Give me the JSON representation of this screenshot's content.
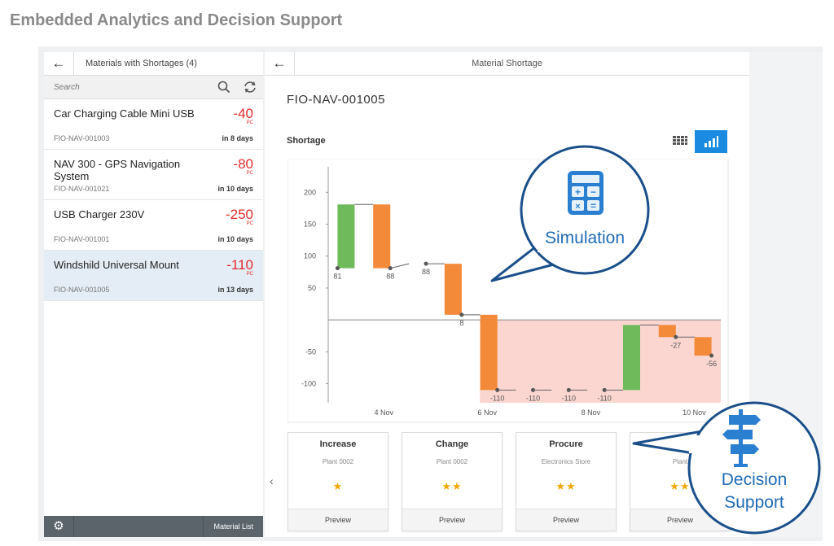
{
  "slide": {
    "title": "Embedded Analytics and Decision Support"
  },
  "master": {
    "header_title": "Materials with Shortages (4)",
    "search_placeholder": "Search",
    "items": [
      {
        "title": "Car Charging Cable Mini USB",
        "id": "FIO-NAV-001003",
        "qty": "-40",
        "unit": "PC",
        "days": "in 8 days"
      },
      {
        "title": "NAV 300 - GPS Navigation System",
        "id": "FIO-NAV-001021",
        "qty": "-80",
        "unit": "PC",
        "days": "in 10 days"
      },
      {
        "title": "USB Charger 230V",
        "id": "FIO-NAV-001001",
        "qty": "-250",
        "unit": "PC",
        "days": "in 10 days"
      },
      {
        "title": "Windshild Universal Mount",
        "id": "FIO-NAV-001005",
        "qty": "-110",
        "unit": "PC",
        "days": "in 13 days",
        "selected": true
      }
    ],
    "footer_button": "Material List"
  },
  "detail": {
    "header_title": "Material Shortage",
    "object_title": "FIO-NAV-001005",
    "chart_section_label": "Shortage",
    "cards": [
      {
        "title": "Increase",
        "subtitle": "Plant 0002",
        "stars": "★",
        "preview": "Preview"
      },
      {
        "title": "Change",
        "subtitle": "Plant 0002",
        "stars": "★★",
        "preview": "Preview"
      },
      {
        "title": "Procure",
        "subtitle": "Electronics Store",
        "stars": "★★",
        "preview": "Preview"
      },
      {
        "title": "",
        "subtitle": "Plant",
        "stars": "★★",
        "preview": "Preview"
      }
    ]
  },
  "callouts": {
    "simulation": "Simulation",
    "decision_1": "Decision",
    "decision_2": "Support"
  },
  "colors": {
    "increase": "#6fba5a",
    "decrease": "#f28a3a",
    "shortage_area": "#fbd6d0",
    "accent": "#1a8ae0",
    "callout": "#1a4f8a",
    "qty_red": "#e32b2b"
  },
  "chart_data": {
    "type": "bar",
    "subtype": "waterfall",
    "title": "",
    "xlabel": "",
    "ylabel": "",
    "ylim": [
      -130,
      240
    ],
    "yticks": [
      200,
      150,
      100,
      50,
      -50,
      -100
    ],
    "xtick_labels": [
      "4 Nov",
      "6 Nov",
      "8 Nov",
      "10 Nov"
    ],
    "steps": [
      {
        "start": 81,
        "end": 181,
        "kind": "increase"
      },
      {
        "start": 181,
        "end": 81,
        "kind": "decrease",
        "label": "88"
      },
      {
        "start": 88,
        "end": 88,
        "kind": "flat",
        "label": "88"
      },
      {
        "start": 88,
        "end": 8,
        "kind": "decrease",
        "label": "8"
      },
      {
        "start": 8,
        "end": -110,
        "kind": "decrease",
        "label": "-110"
      },
      {
        "start": -110,
        "end": -110,
        "kind": "flat",
        "label": "-110"
      },
      {
        "start": -110,
        "end": -110,
        "kind": "flat",
        "label": "-110"
      },
      {
        "start": -110,
        "end": -110,
        "kind": "flat",
        "label": "-110"
      },
      {
        "start": -110,
        "end": -8,
        "kind": "increase"
      },
      {
        "start": -8,
        "end": -27,
        "kind": "decrease",
        "label": "-27"
      },
      {
        "start": -27,
        "end": -56,
        "kind": "decrease",
        "label": "-56"
      }
    ],
    "first_label": "81",
    "shortage_region": {
      "from_step": 4,
      "y_top": 0,
      "y_bottom": -140
    }
  }
}
